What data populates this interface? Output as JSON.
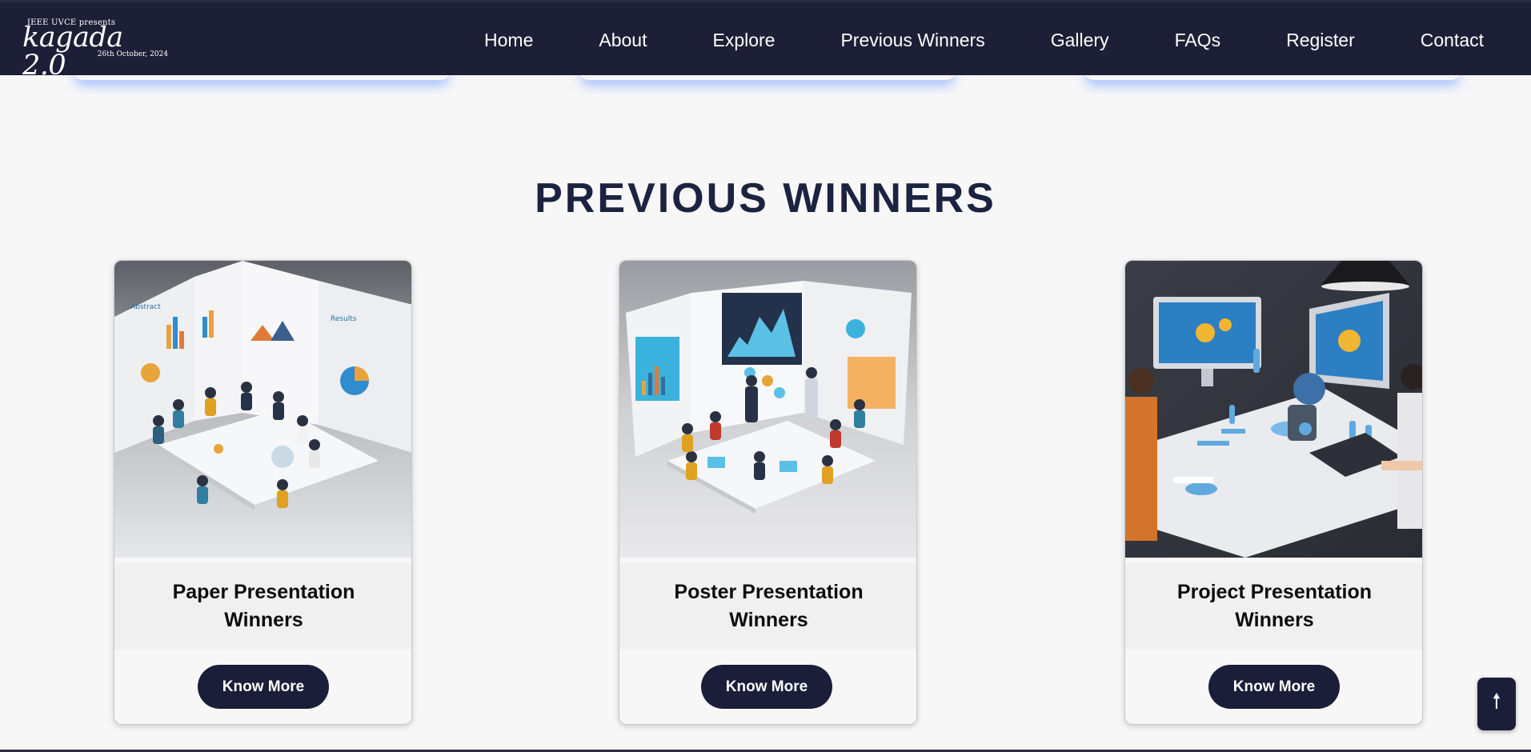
{
  "header": {
    "logo": {
      "pre": "IEEE UVCE presents",
      "name": "kagada 2.0",
      "date": "26th October, 2024"
    },
    "nav": [
      "Home",
      "About",
      "Explore",
      "Previous Winners",
      "Gallery",
      "FAQs",
      "Register",
      "Contact"
    ]
  },
  "section": {
    "title": "PREVIOUS WINNERS",
    "cards": [
      {
        "title": "Paper Presentation Winners",
        "button": "Know More",
        "image": "paper-presentation-illustration"
      },
      {
        "title": "Poster Presentation Winners",
        "button": "Know More",
        "image": "poster-presentation-illustration"
      },
      {
        "title": "Project Presentation Winners",
        "button": "Know More",
        "image": "project-presentation-illustration"
      }
    ]
  },
  "scroll_top": {
    "icon": "arrow-up-icon",
    "label": "🠕"
  },
  "colors": {
    "navbar": "#1c1f35",
    "accent": "#1a1e38",
    "title": "#1c2340",
    "glow": "#4682ff"
  }
}
